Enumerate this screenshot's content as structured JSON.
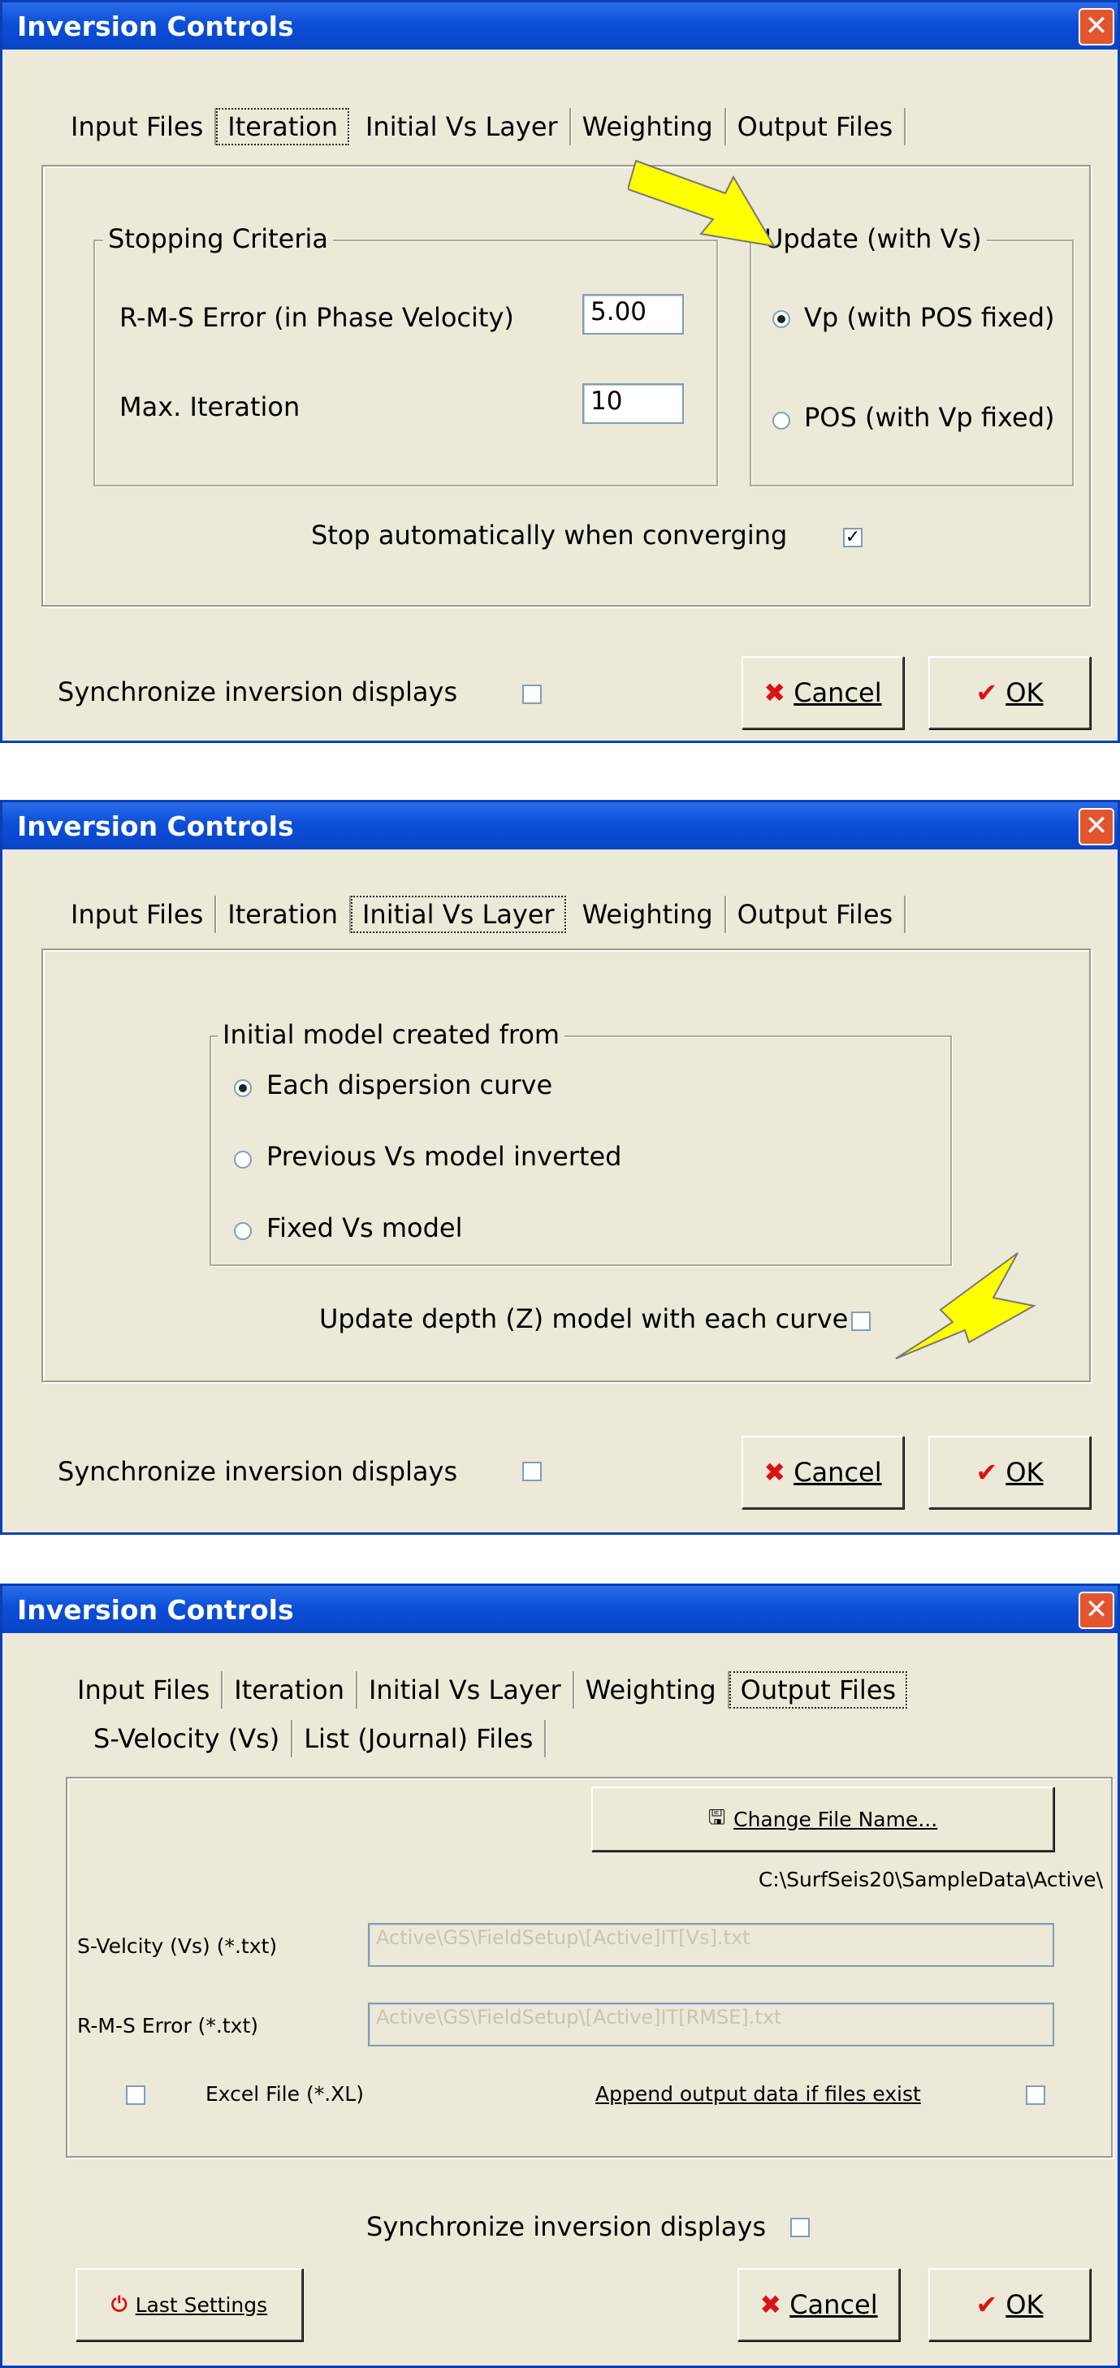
{
  "dialogs": {
    "iteration": {
      "title": "Inversion Controls",
      "tabs": [
        "Input Files",
        "Iteration",
        "Initial Vs Layer",
        "Weighting",
        "Output Files"
      ],
      "stopping_group": "Stopping Criteria",
      "rms_label": "R-M-S Error (in Phase Velocity)",
      "rms_value": "5.00",
      "maxiter_label": "Max. Iteration",
      "maxiter_value": "10",
      "update_group": "Update (with Vs)",
      "vp_option": "Vp (with POS fixed)",
      "pos_option": "POS (with Vp fixed)",
      "stop_auto_label": "Stop automatically when converging",
      "stop_auto_checked": true,
      "sync_label": "Synchronize inversion displays",
      "cancel": "Cancel",
      "ok": "OK"
    },
    "initial": {
      "title": "Inversion Controls",
      "tabs": [
        "Input Files",
        "Iteration",
        "Initial Vs Layer",
        "Weighting",
        "Output Files"
      ],
      "group": "Initial model created from",
      "opt1": "Each dispersion curve",
      "opt2": "Previous Vs model inverted",
      "opt3": "Fixed Vs model",
      "update_depth_label": "Update depth (Z) model with each curve",
      "sync_label": "Synchronize inversion displays",
      "cancel": "Cancel",
      "ok": "OK"
    },
    "output": {
      "title": "Inversion Controls",
      "tabs": [
        "Input Files",
        "Iteration",
        "Initial Vs Layer",
        "Weighting",
        "Output Files"
      ],
      "subtabs": [
        "S-Velocity (Vs)",
        "List (Journal) Files"
      ],
      "change_file_button": "Change File Name...",
      "path": "C:\\SurfSeis20\\SampleData\\Active\\",
      "svel_label": "S-Velcity (Vs) (*.txt)",
      "svel_value": "Active\\GS\\FieldSetup\\[Active]IT[Vs].txt",
      "rms_label": "R-M-S Error (*.txt)",
      "rms_value": "Active\\GS\\FieldSetup\\[Active]IT[RMSE].txt",
      "excel_label": "Excel File (*.XL)",
      "append_label": "Append output data if files exist",
      "sync_label": "Synchronize inversion displays",
      "last_settings": "Last Settings",
      "cancel": "Cancel",
      "ok": "OK"
    }
  },
  "colors": {
    "title_bar": "#0b4fd8",
    "dialog_bg": "#ece9d8",
    "arrow": "#ffff00",
    "cancel_icon": "#dd1111"
  },
  "icons": [
    "close-icon",
    "cancel-x-icon",
    "ok-check-icon",
    "arrow-pointer-icon",
    "save-file-icon",
    "last-settings-icon"
  ]
}
